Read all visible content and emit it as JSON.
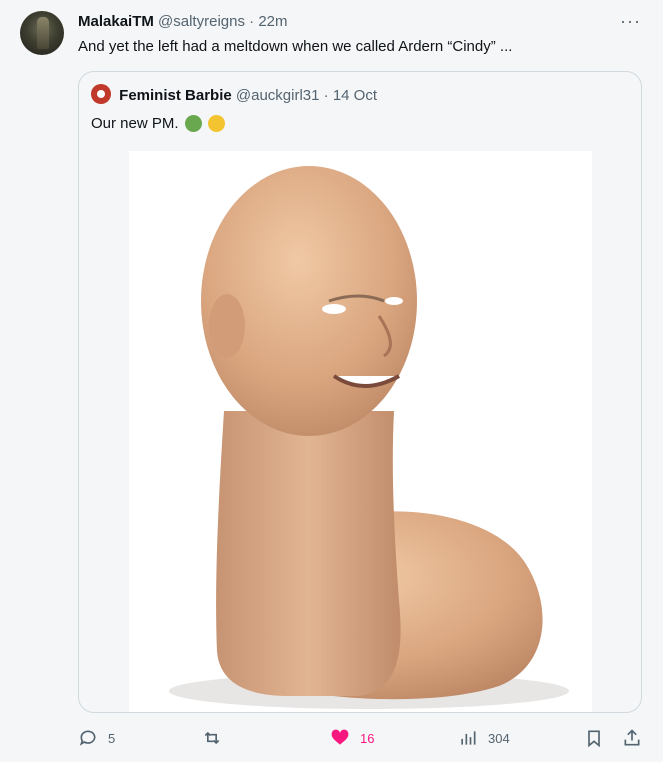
{
  "post": {
    "author_name": "MalakaiTM",
    "author_handle": "@saltyreigns",
    "separator": "·",
    "time": "22m",
    "more_label": "···",
    "text": "And yet the left had a meltdown when we called Ardern “Cindy” ..."
  },
  "quote": {
    "author_name": "Feminist Barbie",
    "author_handle": "@auckgirl31",
    "separator": "·",
    "date": "14 Oct",
    "text": "Our new PM.",
    "emojis": [
      "nauseated-face-icon",
      "face-vomiting-icon"
    ]
  },
  "actions": {
    "replies": "5",
    "reposts": "",
    "likes": "16",
    "views": "304"
  },
  "colors": {
    "text_primary": "#0f1419",
    "text_secondary": "#536471",
    "like_pink": "#f91880",
    "border": "#cfd9de",
    "background": "#f5f6f7"
  }
}
